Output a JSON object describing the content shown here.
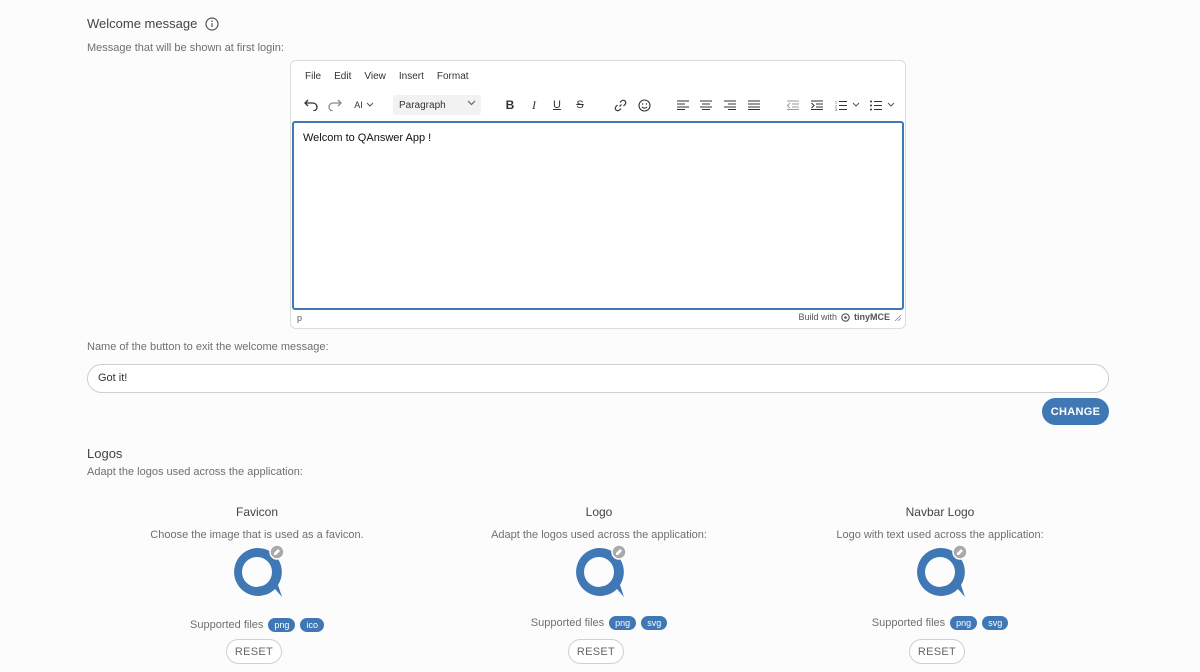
{
  "welcome": {
    "title": "Welcome message",
    "description": "Message that will be shown at first login:"
  },
  "editor": {
    "menu": [
      "File",
      "Edit",
      "View",
      "Insert",
      "Format"
    ],
    "ai_label": "AI",
    "block_format": "Paragraph",
    "content": "Welcom to QAnswer App !",
    "status_path": "p",
    "branding_prefix": "Build with",
    "branding_name": "tinyMCE"
  },
  "exit_button": {
    "label": "Name of the button to exit the welcome message:",
    "value": "Got it!",
    "change_label": "CHANGE"
  },
  "logos": {
    "title": "Logos",
    "description": "Adapt the logos used across the application:",
    "supported_label": "Supported files",
    "reset_label": "RESET",
    "items": [
      {
        "title": "Favicon",
        "description": "Choose the image that is used as a favicon.",
        "formats": [
          "png",
          "ico"
        ]
      },
      {
        "title": "Logo",
        "description": "Adapt the logos used across the application:",
        "formats": [
          "png",
          "svg"
        ]
      },
      {
        "title": "Navbar Logo",
        "description": "Logo with text used across the application:",
        "formats": [
          "png",
          "svg"
        ]
      }
    ]
  },
  "colors": {
    "accent": "#3f78b5",
    "chip": "#3f78b5"
  }
}
